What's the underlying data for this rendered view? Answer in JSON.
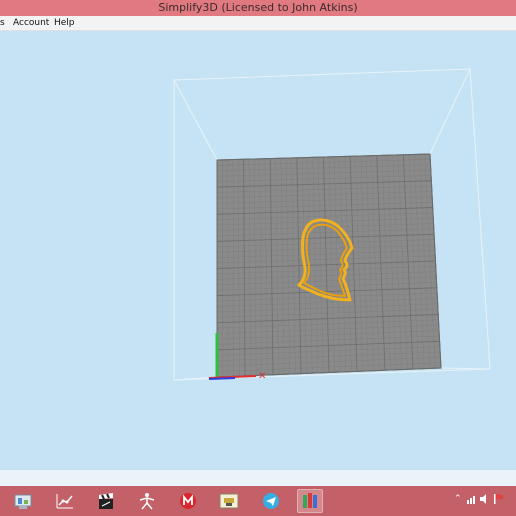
{
  "window": {
    "title": "Simplify3D (Licensed to John Atkins)"
  },
  "menu": {
    "items": [
      {
        "label": "s"
      },
      {
        "label": "Account"
      },
      {
        "label": "Help"
      }
    ]
  },
  "viewport": {
    "background": "#c6e3f5",
    "bed_color": "#8a8a8a",
    "grid_color": "#6e6e6e",
    "model_color": "#f2b21e",
    "axis_colors": {
      "x": "#e03030",
      "y": "#3040e0",
      "z": "#30c040"
    }
  },
  "taskbar": {
    "color": "#c46067",
    "apps": [
      {
        "icon": "control-panel-icon"
      },
      {
        "icon": "graph-app-icon"
      },
      {
        "icon": "film-clapper-icon"
      },
      {
        "icon": "running-figure-icon"
      },
      {
        "icon": "mega-m-icon"
      },
      {
        "icon": "printer-app-icon"
      },
      {
        "icon": "telegram-icon"
      },
      {
        "icon": "simplify3d-icon"
      }
    ],
    "tray": [
      {
        "icon": "chevron-up-icon"
      },
      {
        "icon": "network-icon"
      },
      {
        "icon": "volume-icon"
      },
      {
        "icon": "flag-icon"
      }
    ]
  }
}
